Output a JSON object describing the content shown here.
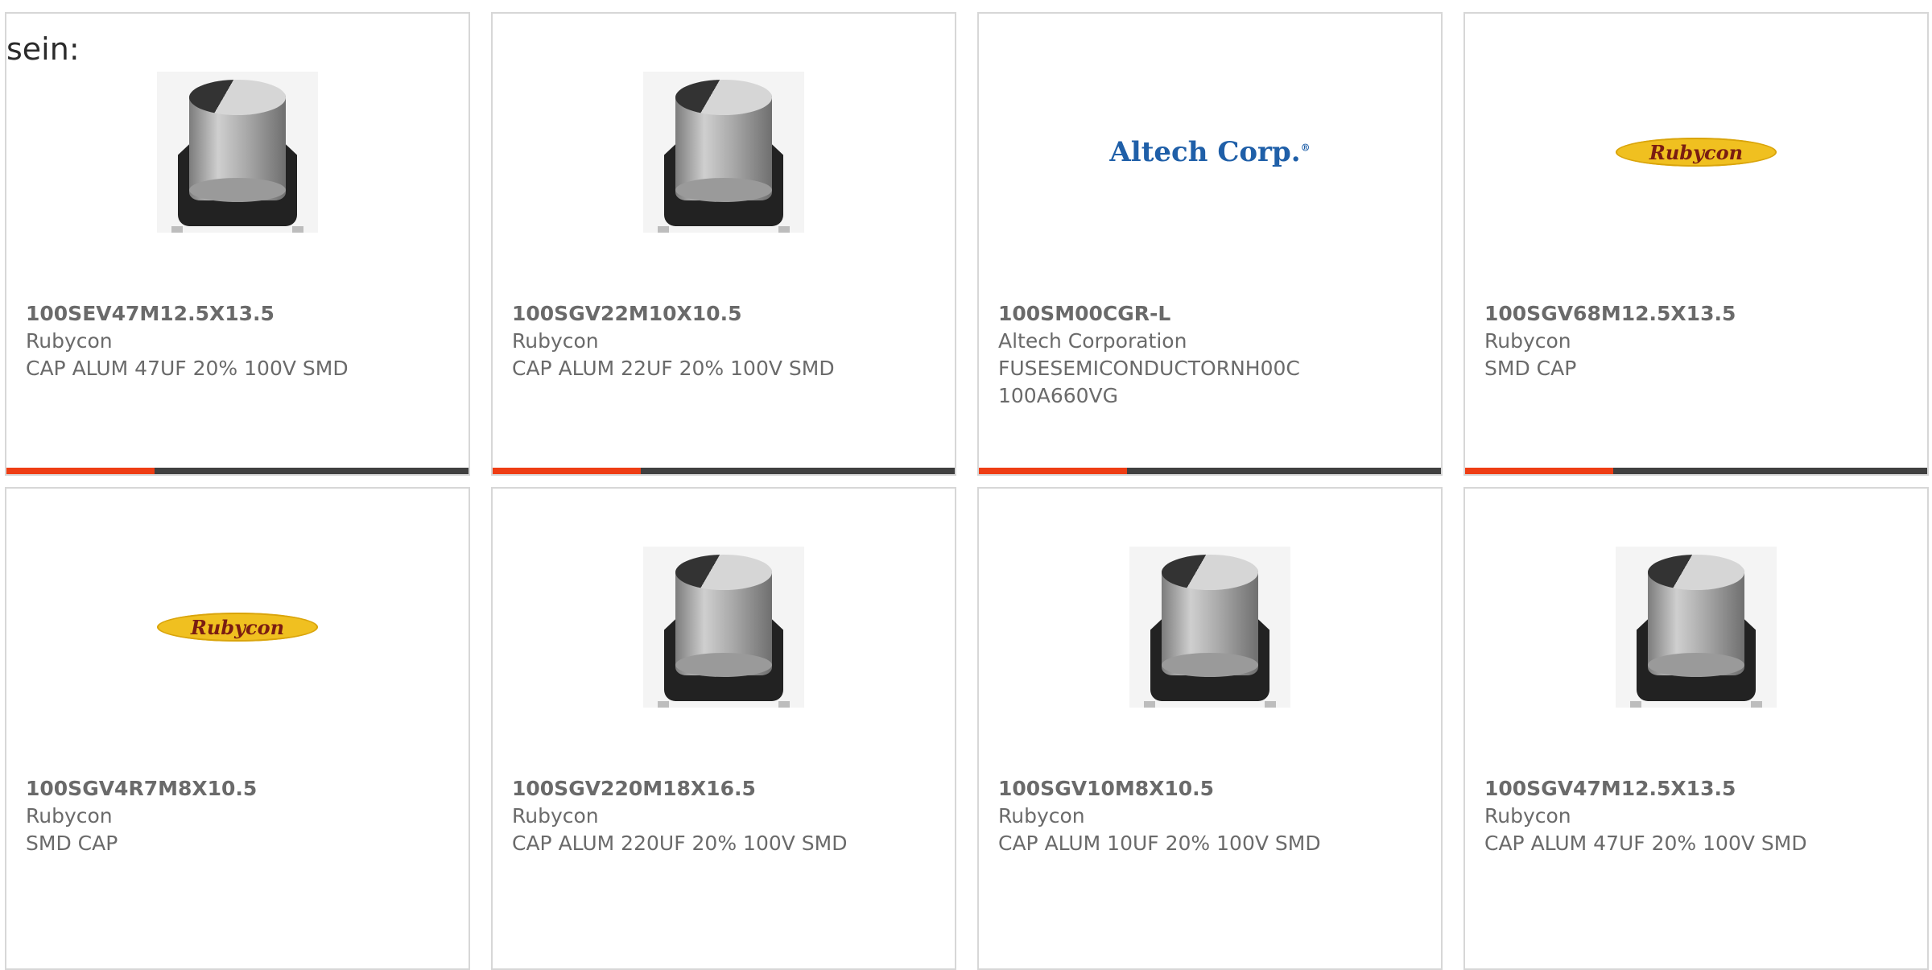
{
  "intro_text": "sein:",
  "products": [
    {
      "part_number": "100SEV47M12.5X13.5",
      "manufacturer": "Rubycon",
      "description": "CAP ALUM 47UF 20% 100V SMD",
      "image": "capacitor-image"
    },
    {
      "part_number": "100SGV22M10X10.5",
      "manufacturer": "Rubycon",
      "description": "CAP ALUM 22UF 20% 100V SMD",
      "image": "capacitor-image"
    },
    {
      "part_number": "100SM00CGR-L",
      "manufacturer": "Altech Corporation",
      "description": "FUSESEMICONDUCTORNH00C 100A660VG",
      "image": "altech-logo",
      "logo_text": "Altech Corp."
    },
    {
      "part_number": "100SGV68M12.5X13.5",
      "manufacturer": "Rubycon",
      "description": "SMD CAP",
      "image": "rubycon-logo",
      "logo_text": "Rubycon"
    },
    {
      "part_number": "100SGV4R7M8X10.5",
      "manufacturer": "Rubycon",
      "description": "SMD CAP",
      "image": "rubycon-logo",
      "logo_text": "Rubycon"
    },
    {
      "part_number": "100SGV220M18X16.5",
      "manufacturer": "Rubycon",
      "description": "CAP ALUM 220UF 20% 100V SMD",
      "image": "capacitor-image"
    },
    {
      "part_number": "100SGV10M8X10.5",
      "manufacturer": "Rubycon",
      "description": "CAP ALUM 10UF 20% 100V SMD",
      "image": "capacitor-image"
    },
    {
      "part_number": "100SGV47M12.5X13.5",
      "manufacturer": "Rubycon",
      "description": "CAP ALUM 47UF 20% 100V SMD",
      "image": "capacitor-image"
    }
  ],
  "colors": {
    "accent": "#ee3d14",
    "bar": "#404040",
    "border": "#d7d7d7",
    "text": "#6a6a6a"
  }
}
